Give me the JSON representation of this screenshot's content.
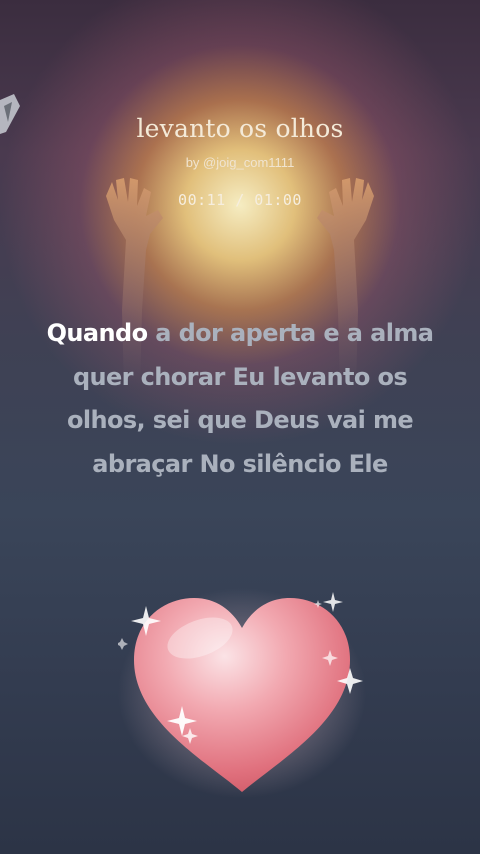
{
  "song": {
    "title": "levanto os olhos",
    "byline": "by @joig_com1111",
    "timer": "00:11 / 01:00"
  },
  "lyrics": {
    "active_word": "Quando",
    "rest": " a dor aperta e a alma quer chorar Eu levanto os olhos, sei que Deus vai me abraçar No silêncio Ele"
  },
  "icons": {
    "heart": "heart-icon",
    "corner": "corner-logo-icon"
  },
  "colors": {
    "active_text": "#ffffff",
    "inactive_text": "#aab1bd",
    "title_text": "#f4ead8",
    "heart": "#e87a86"
  }
}
